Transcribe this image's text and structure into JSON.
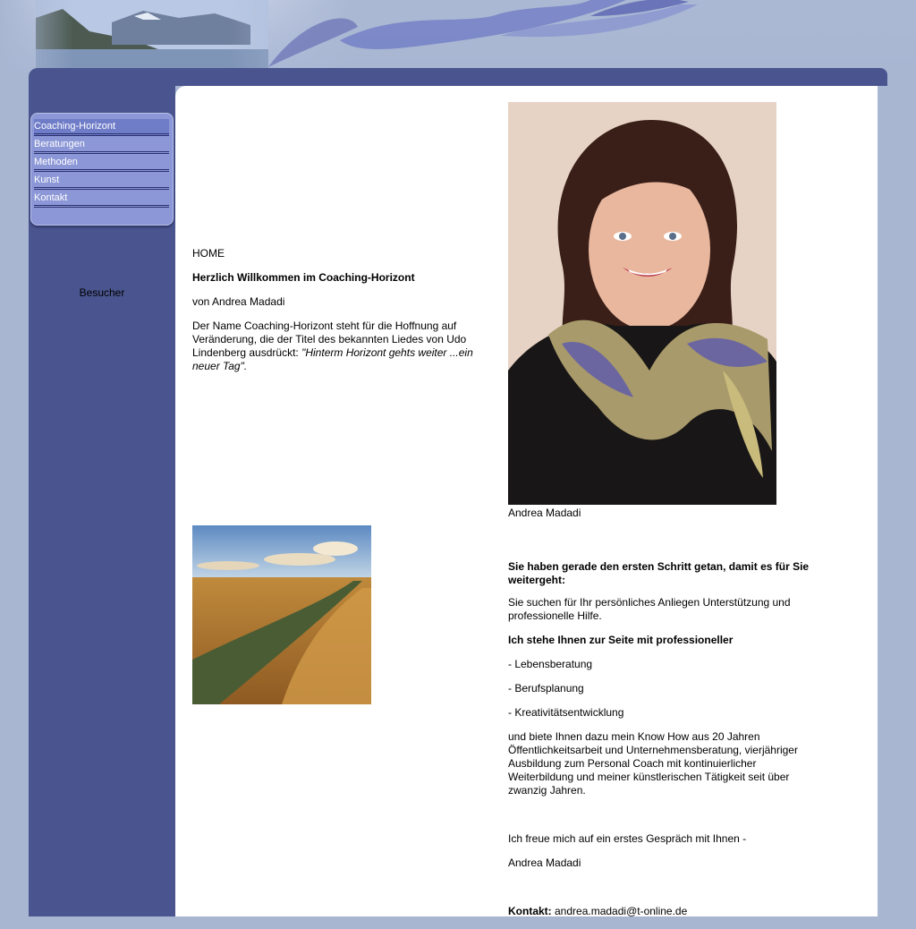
{
  "nav": {
    "items": [
      {
        "label": "Coaching-Horizont"
      },
      {
        "label": "Beratungen"
      },
      {
        "label": "Methoden"
      },
      {
        "label": "Kunst"
      },
      {
        "label": "Kontakt"
      }
    ]
  },
  "sidebar": {
    "visitors_label": "Besucher"
  },
  "intro": {
    "home": "HOME",
    "welcome": "Herzlich Willkommen im Coaching-Horizont",
    "author": "von  Andrea Madadi",
    "text": "Der Name Coaching-Horizont steht für die Hoffnung auf Veränderung, die der Titel des bekannten Liedes von Udo Lindenberg ausdrückt: ",
    "quote": "\"Hinterm Horizont gehts weiter ...ein neuer Tag\"."
  },
  "portrait": {
    "caption": "Andrea Madadi"
  },
  "offer": {
    "headline": "Sie haben gerade den ersten Schritt getan, damit es für Sie weitergeht:",
    "support": "Sie suchen für Ihr persönliches Anliegen Unterstützung und professionelle Hilfe.",
    "stand": "Ich stehe Ihnen zur Seite mit professioneller",
    "bullets": [
      "- Lebensberatung",
      "- Berufsplanung",
      "- Kreativitätsentwicklung"
    ],
    "experience": "und biete Ihnen dazu mein Know How aus 20 Jahren Öffentlichkeitsarbeit und Unternehmensberatung, vierjähriger Ausbildung zum Personal Coach mit kontinuierlicher Weiterbildung  und meiner künstlerischen Tätigkeit seit über zwanzig Jahren.",
    "closing": "Ich freue mich auf ein erstes Gespräch mit Ihnen -",
    "signature": "Andrea Madadi",
    "contact_label": "Kontakt:",
    "contact_email": " andrea.madadi@t-online.de"
  },
  "colors": {
    "frame": "#4a548e",
    "nav": "#8b97d6",
    "background": "#a8b6d2"
  }
}
